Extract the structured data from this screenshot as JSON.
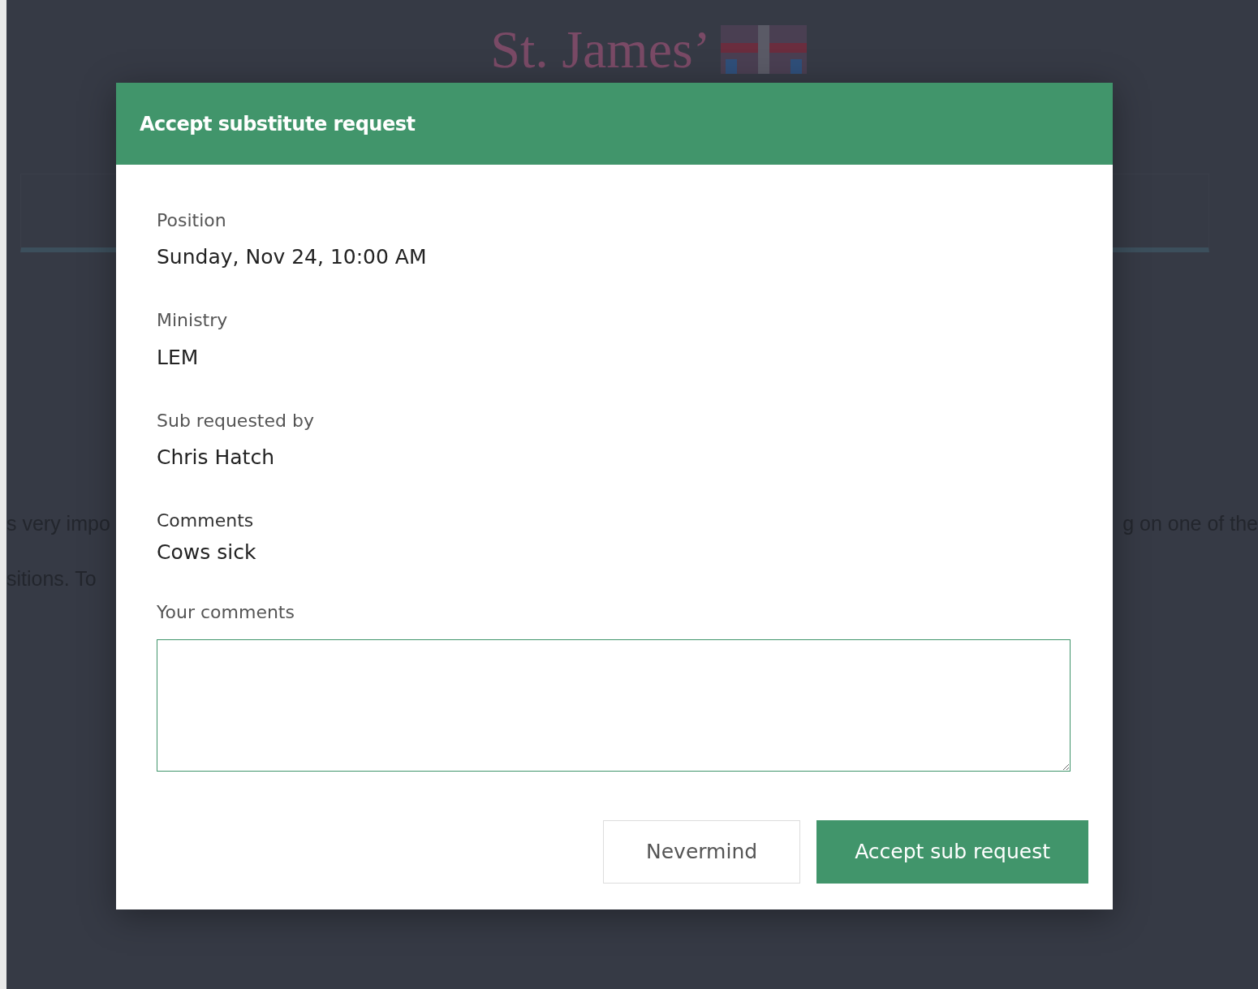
{
  "background_page": {
    "logo": "St. James’",
    "text_lines": [
      {
        "left": "s very impo",
        "right": "g on one of the"
      },
      {
        "left": "sitions. To"
      }
    ]
  },
  "dialog": {
    "title": "Accept substitute request",
    "fields": [
      {
        "label": "Position",
        "value": "Sunday, Nov 24, 10:00 AM"
      },
      {
        "label": "Ministry",
        "value": "LEM"
      },
      {
        "label": "Sub requested by",
        "value": "Chris Hatch"
      },
      {
        "label": "Comments",
        "value": "Cows sick"
      }
    ],
    "comment_field": {
      "label": "Your comments",
      "focused": true
    },
    "buttons": [
      {
        "label": "Nevermind",
        "kind": "secondary"
      },
      {
        "label": "Accept sub request",
        "kind": "primary"
      }
    ]
  }
}
